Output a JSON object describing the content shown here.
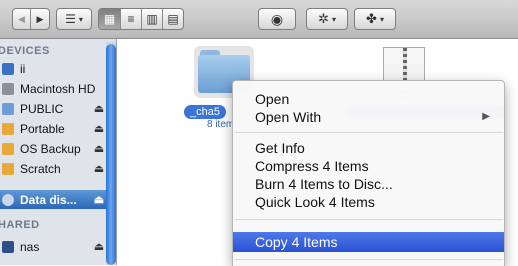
{
  "toolbar": {
    "nav_back": "◀",
    "nav_forward": "▶",
    "arrange_icon": "☰",
    "view_icons": [
      "▦",
      "≡",
      "▥",
      "▤"
    ],
    "eye_icon": "◉",
    "gear_icon": "✲",
    "share_icon": "✤"
  },
  "sidebar": {
    "sections": [
      {
        "title": "DEVICES"
      },
      {
        "title": "HARED"
      }
    ],
    "items": [
      {
        "label": "ii",
        "color": "#3a6fc2",
        "eject": ""
      },
      {
        "label": "Macintosh HD",
        "color": "#8a8f99",
        "eject": ""
      },
      {
        "label": "PUBLIC",
        "color": "#6d9cd8",
        "eject": "⏏"
      },
      {
        "label": "Portable",
        "color": "#e8a93a",
        "eject": "⏏"
      },
      {
        "label": "OS Backup",
        "color": "#e8a93a",
        "eject": "⏏"
      },
      {
        "label": "Scratch",
        "color": "#e8a93a",
        "eject": "⏏"
      },
      {
        "label": "Data dis...",
        "color": "#c9d6ea",
        "eject": "⏏",
        "selected": true
      },
      {
        "label": "nas",
        "color": "#2f4f8a",
        "eject": "⏏"
      }
    ]
  },
  "files": [
    {
      "name": "_cha5",
      "subtitle": "8 item"
    },
    {
      "name": "",
      "subtitle": ""
    }
  ],
  "context_menu": {
    "groups": [
      [
        {
          "label": "Open",
          "submenu": false
        },
        {
          "label": "Open With",
          "submenu": true
        }
      ],
      [
        {
          "label": "Get Info"
        },
        {
          "label": "Compress 4 Items"
        },
        {
          "label": "Burn 4 Items to Disc..."
        },
        {
          "label": "Quick Look 4 Items"
        }
      ],
      [
        {
          "label": "Copy 4 Items",
          "highlighted": true
        }
      ]
    ],
    "highlight_color": "#2a52d6"
  }
}
